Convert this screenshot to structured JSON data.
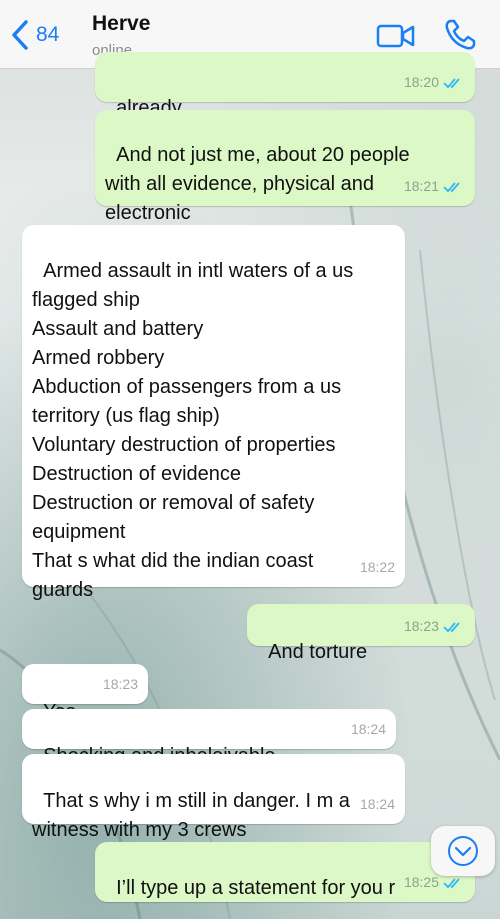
{
  "header": {
    "back_count": "84",
    "contact_name": "Herve",
    "contact_status": "online"
  },
  "messages": [
    {
      "dir": "out",
      "text": "already",
      "time": "18:20",
      "ticks": "double-blue-check-icon"
    },
    {
      "dir": "out",
      "text": "And not just me, about 20 people\nwith all evidence, physical and\nelectronic",
      "time": "18:21",
      "ticks": "double-blue-check-icon"
    },
    {
      "dir": "in",
      "text": "Armed assault in intl waters of a us\nflagged ship\nAssault and battery\nArmed robbery\nAbduction of passengers from a us\nterritory (us flag ship)\nVoluntary destruction of properties\nDestruction of evidence\nDestruction or removal of safety\nequipment\nThat s what did the indian coast\nguards",
      "time": "18:22"
    },
    {
      "dir": "out",
      "text": "And torture",
      "time": "18:23",
      "ticks": "double-blue-check-icon"
    },
    {
      "dir": "in",
      "text": "Yes",
      "time": "18:23"
    },
    {
      "dir": "in",
      "text": "Shocking and inbeleivable",
      "time": "18:24"
    },
    {
      "dir": "in",
      "text": "That s why i m still in danger. I m a\nwitness with my 3 crews",
      "time": "18:24"
    },
    {
      "dir": "out",
      "text": "I’ll type up a statement for you r",
      "time": "18:25",
      "ticks": "double-blue-check-icon"
    }
  ],
  "colors": {
    "accent": "#1a7ef5",
    "outgoing_bubble": "#dcf8c6",
    "incoming_bubble": "#ffffff",
    "read_ticks": "#34b7f1"
  },
  "icons": {
    "back": "chevron-left-icon",
    "video": "video-camera-icon",
    "call": "phone-icon",
    "scroll": "chevron-down-icon"
  }
}
